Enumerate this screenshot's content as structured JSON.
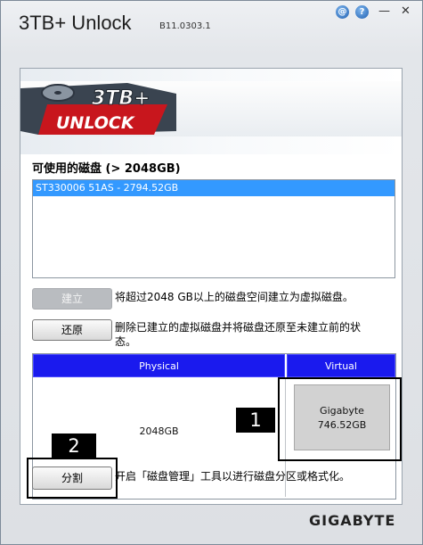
{
  "window": {
    "title": "3TB+ Unlock",
    "version": "B11.0303.1",
    "help_symbol": "?",
    "minimize_symbol": "—",
    "close_symbol": "✕"
  },
  "logo": {
    "line1": "3TB+",
    "line2": "UNLOCK"
  },
  "disks": {
    "title": "可使用的磁盘 (> 2048GB)",
    "items": [
      "ST330006 51AS - 2794.52GB"
    ]
  },
  "actions": {
    "create_label": "建立",
    "create_desc": "将超过2048 GB以上的磁盘空间建立为虚拟磁盘。",
    "restore_label": "还原",
    "restore_desc_1": "删除已建立的虚拟磁盘并将磁盘还原至未建立前的状",
    "restore_desc_2": "态。",
    "partition_label": "分割",
    "partition_desc": "开启「磁盘管理」工具以进行磁盘分区或格式化。"
  },
  "table": {
    "physical_header": "Physical",
    "virtual_header": "Virtual",
    "physical_value": "2048GB",
    "virtual_name": "Gigabyte",
    "virtual_size": "746.52GB"
  },
  "annotations": {
    "badge_1": "1",
    "badge_2": "2"
  },
  "brand": {
    "logo_text": "GIGABYTE"
  },
  "colors": {
    "selection": "#3399ff",
    "table_header": "#1a1aee",
    "logo_red": "#c8161d"
  }
}
